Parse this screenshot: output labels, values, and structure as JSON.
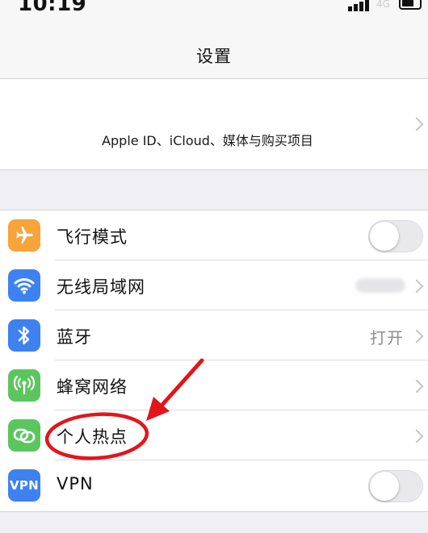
{
  "status_bar": {
    "time": "10:19",
    "network": "4G"
  },
  "nav": {
    "title": "设置"
  },
  "account": {
    "label": "Apple ID、iCloud、媒体与购买项目"
  },
  "settings": [
    {
      "id": "airplane",
      "label": "飞行模式",
      "icon": "airplane-icon",
      "icon_color": "#f7a43a",
      "control": "toggle",
      "toggle_on": false
    },
    {
      "id": "wifi",
      "label": "无线局域网",
      "icon": "wifi-icon",
      "icon_color": "#3d82f0",
      "control": "chevron",
      "value_hidden": true
    },
    {
      "id": "bluetooth",
      "label": "蓝牙",
      "icon": "bluetooth-icon",
      "icon_color": "#3d82f0",
      "control": "chevron",
      "value": "打开"
    },
    {
      "id": "cellular",
      "label": "蜂窝网络",
      "icon": "cellular-antenna-icon",
      "icon_color": "#5cc65e",
      "control": "chevron"
    },
    {
      "id": "hotspot",
      "label": "个人热点",
      "icon": "hotspot-link-icon",
      "icon_color": "#5cc65e",
      "control": "chevron",
      "highlighted": true
    },
    {
      "id": "vpn",
      "label": "VPN",
      "icon": "vpn-icon",
      "icon_text": "VPN",
      "icon_color": "#3d82f0",
      "control": "toggle",
      "toggle_on": false
    }
  ],
  "annotation": {
    "color": "#e3151b",
    "target": "hotspot"
  }
}
